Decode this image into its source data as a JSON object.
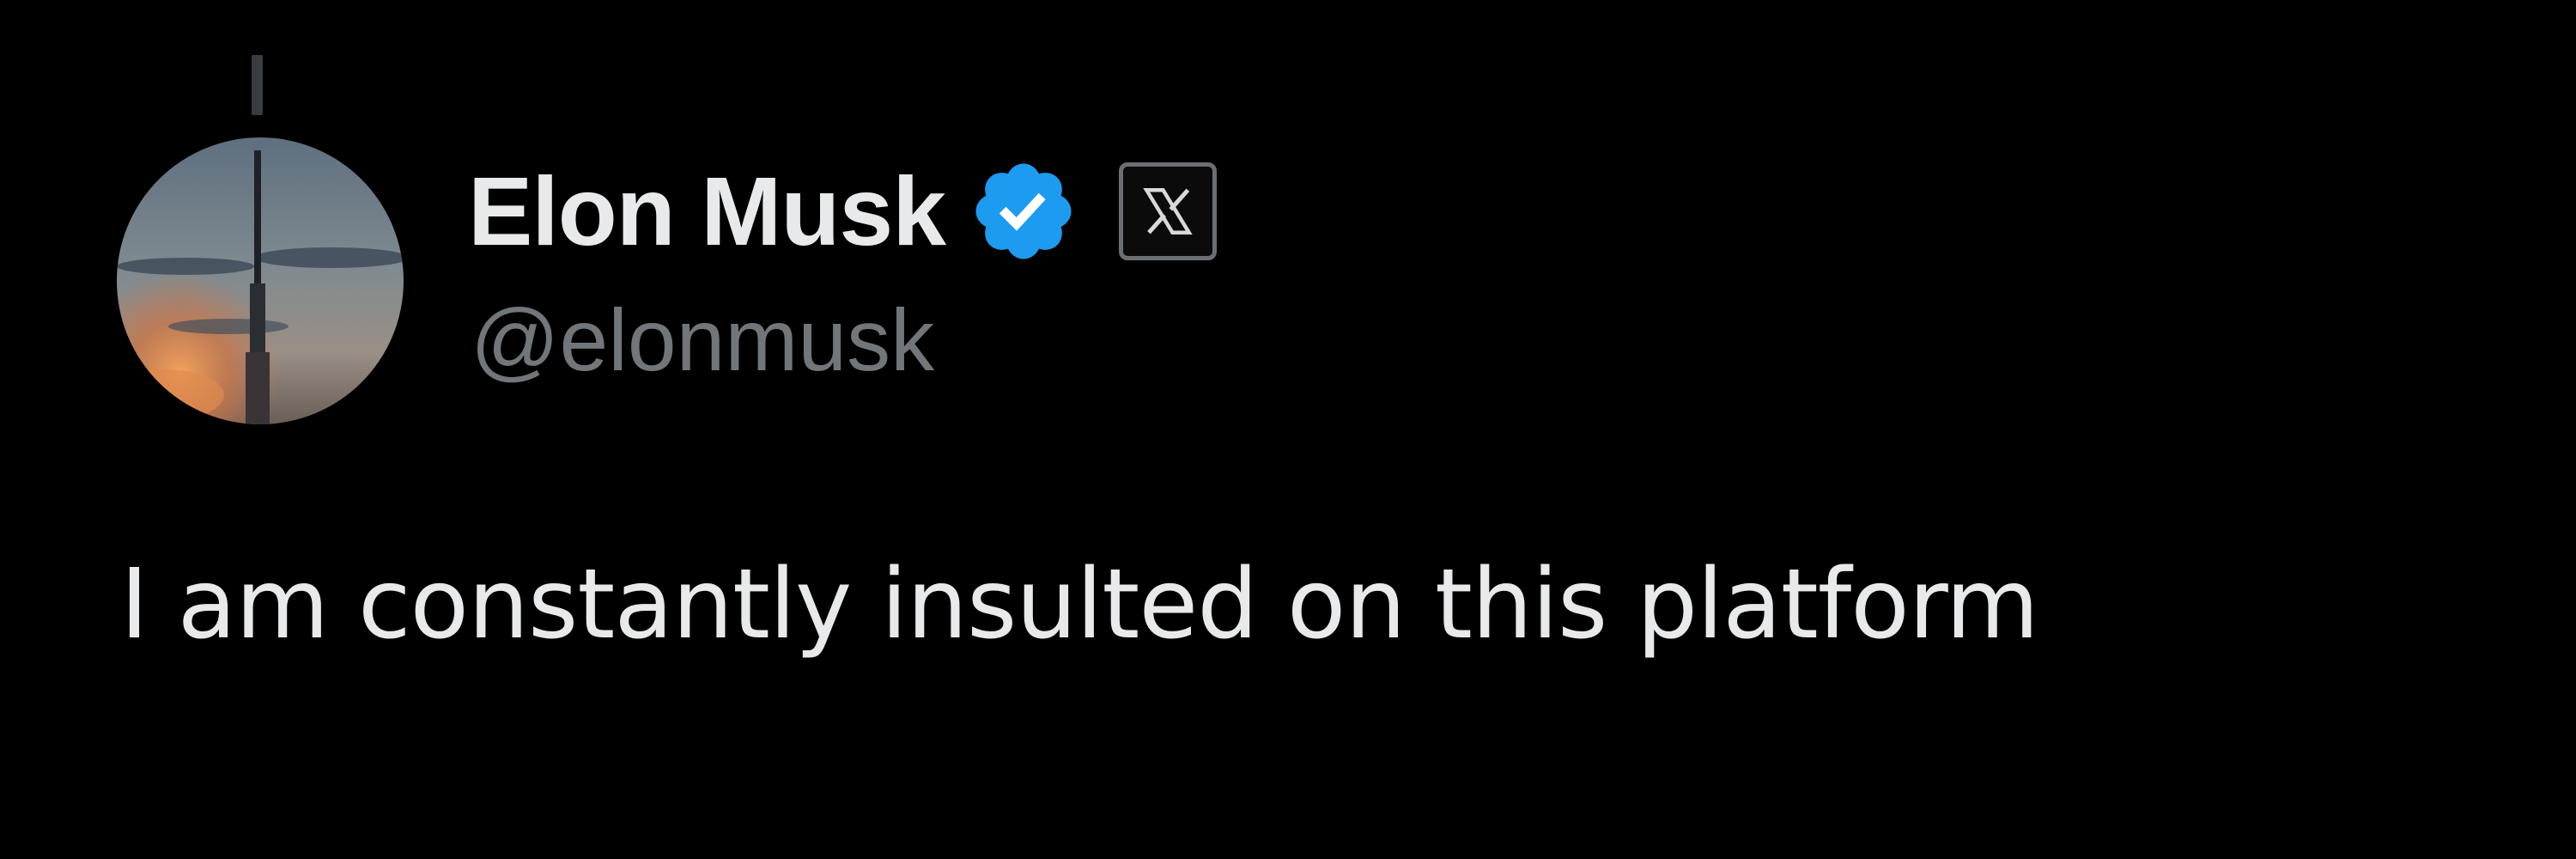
{
  "post": {
    "author": {
      "display_name": "Elon Musk",
      "handle": "@elonmusk",
      "verified": true,
      "verified_color": "#1d9bf0",
      "affiliate_badge_icon": "x-logo-icon"
    },
    "text": "I am constantly insulted on this platform"
  },
  "colors": {
    "background": "#000000",
    "primary_text": "#e7e9ea",
    "secondary_text": "#71767b",
    "thread_line": "#3a3d40"
  }
}
